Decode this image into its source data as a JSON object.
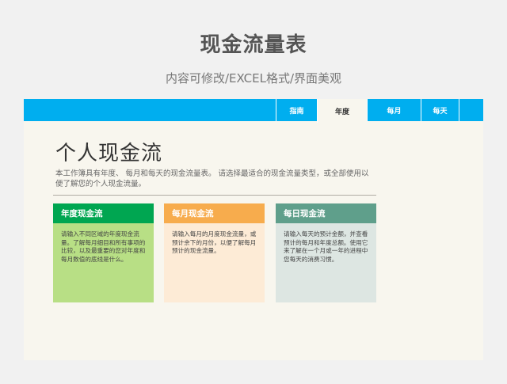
{
  "header": {
    "title": "现金流量表",
    "subtitle": "内容可修改/EXCEL格式/界面美观"
  },
  "tabs": [
    {
      "label": "指南"
    },
    {
      "label": "年度"
    },
    {
      "label": "每月"
    },
    {
      "label": "每天"
    },
    {
      "label": ""
    }
  ],
  "sheet": {
    "title": "个人现金流",
    "description": "本工作簿具有年度、 每月和每天的现金流量表。 请选择最适合的现金流量类型，或全部使用以便了解您的个人现金流量。"
  },
  "cards": [
    {
      "title": "年度现金流",
      "body": "请输入不同区域的年度现金流量。了解每月细目和所有事项的比较，以及最重要的您对年度和每月数值的底线是什么。",
      "head_color": "#00a651",
      "body_color": "#b8df85"
    },
    {
      "title": "每月现金流",
      "body": "请输入每月的月度现金流量，或预计余下的月份，以便了解每月预计的现金流量。",
      "head_color": "#f7ac4d",
      "body_color": "#fdebd6"
    },
    {
      "title": "每日现金流",
      "body": "请输入每天的预计金额，并查看预计的每月和年度总额。使用它来了解在一个月或一年的进程中您每天的消费习惯。",
      "head_color": "#5f9f8b",
      "body_color": "#dde6e2"
    }
  ]
}
